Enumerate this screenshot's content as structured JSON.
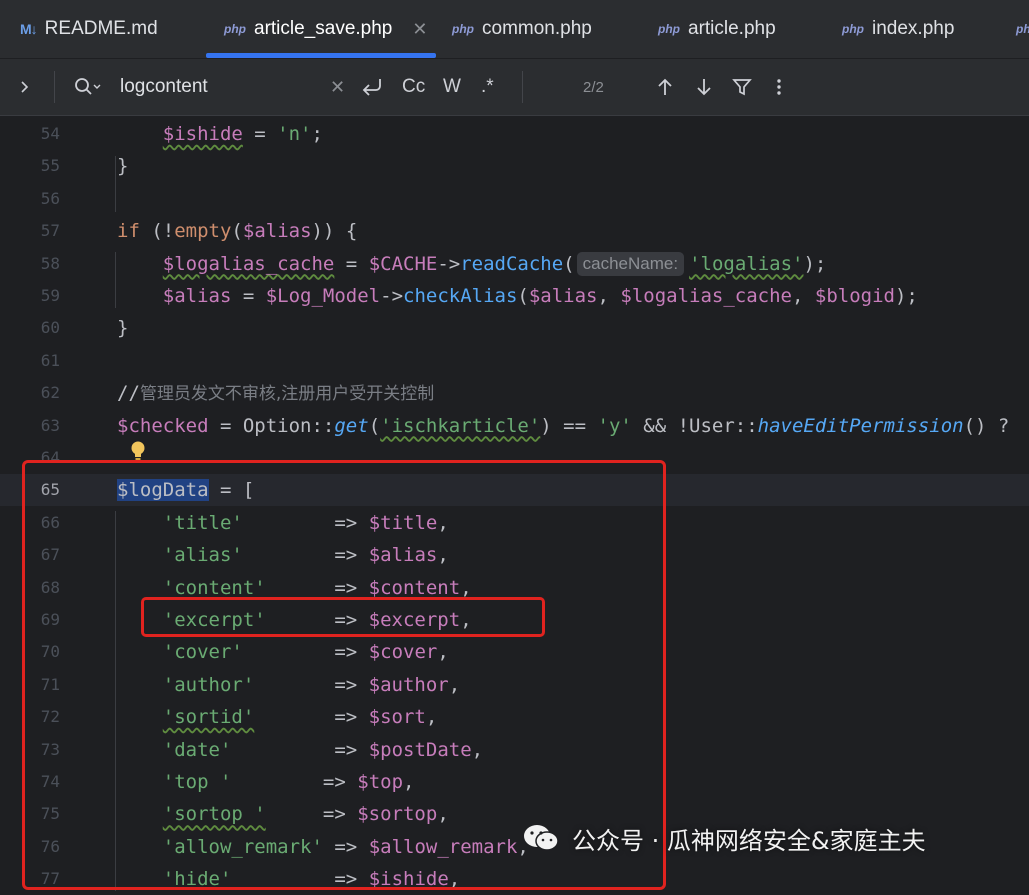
{
  "tabs": [
    {
      "icon": "M↓",
      "label": "README.md"
    },
    {
      "icon": "php",
      "label": "article_save.php",
      "active": true
    },
    {
      "icon": "php",
      "label": "common.php"
    },
    {
      "icon": "php",
      "label": "article.php"
    },
    {
      "icon": "php",
      "label": "index.php"
    },
    {
      "icon": "php",
      "label": ""
    }
  ],
  "search": {
    "query": "logcontent",
    "match_count": "2/2",
    "case_label": "Cc",
    "word_label": "W",
    "regex_label": ".*"
  },
  "lines": [
    {
      "num": "54",
      "tokens": [
        [
          "p",
          "    "
        ],
        [
          "vw",
          "$ishide"
        ],
        [
          "p",
          " = "
        ],
        [
          "s",
          "'n'"
        ],
        [
          "p",
          ";"
        ]
      ]
    },
    {
      "num": "55",
      "tokens": [
        [
          "p",
          "}"
        ]
      ]
    },
    {
      "num": "56",
      "tokens": []
    },
    {
      "num": "57",
      "tokens": [
        [
          "k",
          "if"
        ],
        [
          "p",
          " (!"
        ],
        [
          "k",
          "empty"
        ],
        [
          "p",
          "("
        ],
        [
          "v",
          "$alias"
        ],
        [
          "p",
          ")) {"
        ]
      ]
    },
    {
      "num": "58",
      "tokens": [
        [
          "p",
          "    "
        ],
        [
          "vw",
          "$logalias_cache"
        ],
        [
          "p",
          " = "
        ],
        [
          "v",
          "$CACHE"
        ],
        [
          "p",
          "->"
        ],
        [
          "f",
          "readCache"
        ],
        [
          "p",
          "("
        ],
        [
          "hint",
          "cacheName:"
        ],
        [
          "sw",
          "'logalias'"
        ],
        [
          "p",
          ");"
        ]
      ]
    },
    {
      "num": "59",
      "tokens": [
        [
          "p",
          "    "
        ],
        [
          "v",
          "$alias"
        ],
        [
          "p",
          " = "
        ],
        [
          "v",
          "$Log_Model"
        ],
        [
          "p",
          "->"
        ],
        [
          "f",
          "checkAlias"
        ],
        [
          "p",
          "("
        ],
        [
          "v",
          "$alias"
        ],
        [
          "p",
          ", "
        ],
        [
          "v",
          "$logalias_cache"
        ],
        [
          "p",
          ", "
        ],
        [
          "v",
          "$blogid"
        ],
        [
          "p",
          ");"
        ]
      ]
    },
    {
      "num": "60",
      "tokens": [
        [
          "p",
          "}"
        ]
      ]
    },
    {
      "num": "61",
      "tokens": []
    },
    {
      "num": "62",
      "tokens": [
        [
          "p",
          "//"
        ],
        [
          "cm",
          "管理员发文不审核,注册用户受开关控制"
        ]
      ]
    },
    {
      "num": "63",
      "tokens": [
        [
          "v",
          "$checked"
        ],
        [
          "p",
          " = Option::"
        ],
        [
          "fi",
          "get"
        ],
        [
          "p",
          "("
        ],
        [
          "sw",
          "'ischkarticle'"
        ],
        [
          "p",
          ") == "
        ],
        [
          "s",
          "'y'"
        ],
        [
          "p",
          " && !User::"
        ],
        [
          "fi",
          "haveEditPermission"
        ],
        [
          "p",
          "() ?"
        ]
      ]
    },
    {
      "num": "64",
      "tokens": []
    },
    {
      "num": "65",
      "current": true,
      "tokens": [
        [
          "sel",
          "$logData"
        ],
        [
          "p",
          " = ["
        ]
      ]
    },
    {
      "num": "66",
      "tokens": [
        [
          "p",
          "    "
        ],
        [
          "s",
          "'title'"
        ],
        [
          "p",
          "        => "
        ],
        [
          "v",
          "$title"
        ],
        [
          "p",
          ","
        ]
      ]
    },
    {
      "num": "67",
      "tokens": [
        [
          "p",
          "    "
        ],
        [
          "s",
          "'alias'"
        ],
        [
          "p",
          "        => "
        ],
        [
          "v",
          "$alias"
        ],
        [
          "p",
          ","
        ]
      ]
    },
    {
      "num": "68",
      "tokens": [
        [
          "p",
          "    "
        ],
        [
          "s",
          "'content'"
        ],
        [
          "p",
          "      => "
        ],
        [
          "v",
          "$content"
        ],
        [
          "p",
          ","
        ]
      ]
    },
    {
      "num": "69",
      "tokens": [
        [
          "p",
          "    "
        ],
        [
          "s",
          "'excerpt'"
        ],
        [
          "p",
          "      => "
        ],
        [
          "v",
          "$excerpt"
        ],
        [
          "p",
          ","
        ]
      ]
    },
    {
      "num": "70",
      "tokens": [
        [
          "p",
          "    "
        ],
        [
          "s",
          "'cover'"
        ],
        [
          "p",
          "        => "
        ],
        [
          "v",
          "$cover"
        ],
        [
          "p",
          ","
        ]
      ]
    },
    {
      "num": "71",
      "tokens": [
        [
          "p",
          "    "
        ],
        [
          "s",
          "'author'"
        ],
        [
          "p",
          "       => "
        ],
        [
          "v",
          "$author"
        ],
        [
          "p",
          ","
        ]
      ]
    },
    {
      "num": "72",
      "tokens": [
        [
          "p",
          "    "
        ],
        [
          "sw",
          "'sortid'"
        ],
        [
          "p",
          "       => "
        ],
        [
          "v",
          "$sort"
        ],
        [
          "p",
          ","
        ]
      ]
    },
    {
      "num": "73",
      "tokens": [
        [
          "p",
          "    "
        ],
        [
          "s",
          "'date'"
        ],
        [
          "p",
          "         => "
        ],
        [
          "v",
          "$postDate"
        ],
        [
          "p",
          ","
        ]
      ]
    },
    {
      "num": "74",
      "tokens": [
        [
          "p",
          "    "
        ],
        [
          "s",
          "'top '"
        ],
        [
          "p",
          "        => "
        ],
        [
          "v",
          "$top"
        ],
        [
          "p",
          ","
        ]
      ]
    },
    {
      "num": "75",
      "tokens": [
        [
          "p",
          "    "
        ],
        [
          "sw",
          "'sortop '"
        ],
        [
          "p",
          "     => "
        ],
        [
          "v",
          "$sortop"
        ],
        [
          "p",
          ","
        ]
      ]
    },
    {
      "num": "76",
      "tokens": [
        [
          "p",
          "    "
        ],
        [
          "s",
          "'allow_remark'"
        ],
        [
          "p",
          " => "
        ],
        [
          "v",
          "$allow_remark"
        ],
        [
          "p",
          ","
        ]
      ]
    },
    {
      "num": "77",
      "tokens": [
        [
          "p",
          "    "
        ],
        [
          "s",
          "'hide'"
        ],
        [
          "p",
          "         => "
        ],
        [
          "v",
          "$ishide"
        ],
        [
          "p",
          ","
        ]
      ]
    }
  ],
  "watermark": {
    "text": "公众号 · 瓜神网络安全&家庭主夫"
  },
  "colors": {
    "background": "#1e1f22",
    "tabbar": "#2b2d30",
    "accent": "#3574f0",
    "annotation_red": "#e0231f"
  }
}
